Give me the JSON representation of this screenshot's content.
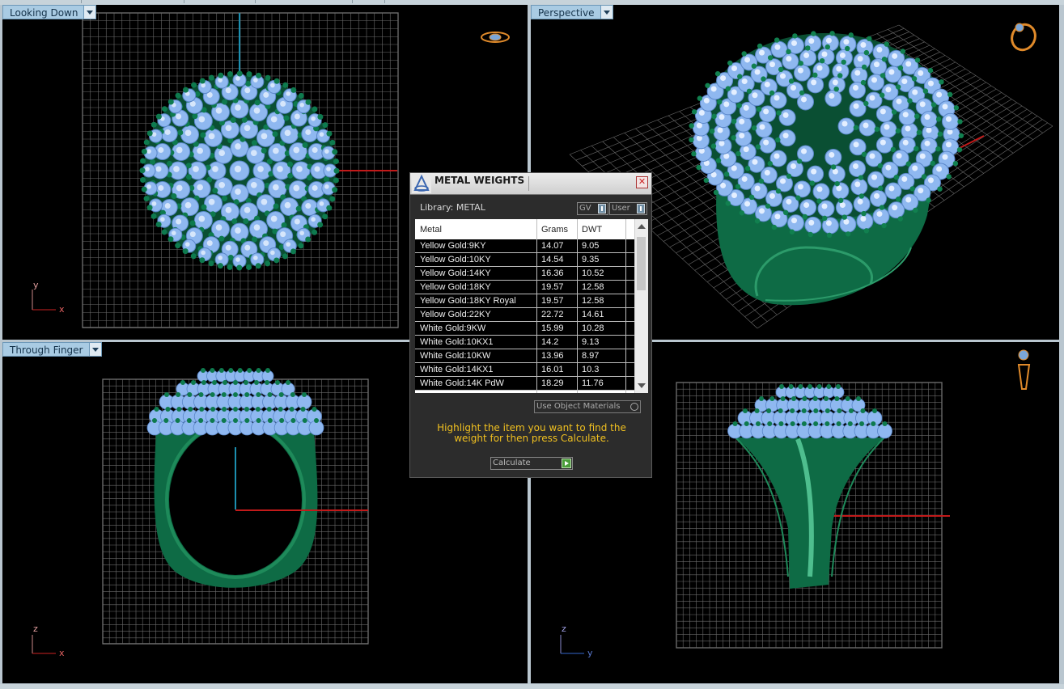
{
  "viewports": {
    "top_left": {
      "label": "Looking Down",
      "axis_v": "y",
      "axis_h": "x"
    },
    "top_right": {
      "label": "Perspective"
    },
    "bottom_left": {
      "label": "Through Finger",
      "axis_v": "z",
      "axis_h": "x"
    },
    "bottom_right": {
      "label": "",
      "axis_v": "z",
      "axis_h": "y"
    }
  },
  "dialog": {
    "title": "METAL WEIGHTS",
    "library_label": "Library: METAL",
    "toggle_gv": "GV",
    "toggle_user": "User",
    "columns": [
      "Metal",
      "Grams",
      "DWT"
    ],
    "rows": [
      {
        "metal": "Yellow Gold:9KY",
        "grams": "14.07",
        "dwt": "9.05"
      },
      {
        "metal": "Yellow Gold:10KY",
        "grams": "14.54",
        "dwt": "9.35"
      },
      {
        "metal": "Yellow Gold:14KY",
        "grams": "16.36",
        "dwt": "10.52"
      },
      {
        "metal": "Yellow Gold:18KY",
        "grams": "19.57",
        "dwt": "12.58"
      },
      {
        "metal": "Yellow Gold:18KY Royal",
        "grams": "19.57",
        "dwt": "12.58"
      },
      {
        "metal": "Yellow Gold:22KY",
        "grams": "22.72",
        "dwt": "14.61"
      },
      {
        "metal": "White Gold:9KW",
        "grams": "15.99",
        "dwt": "10.28"
      },
      {
        "metal": "White Gold:10KX1",
        "grams": "14.2",
        "dwt": "9.13"
      },
      {
        "metal": "White Gold:10KW",
        "grams": "13.96",
        "dwt": "8.97"
      },
      {
        "metal": "White Gold:14KX1",
        "grams": "16.01",
        "dwt": "10.3"
      },
      {
        "metal": "White Gold:14K PdW",
        "grams": "18.29",
        "dwt": "11.76"
      }
    ],
    "use_object_materials": "Use Object Materials",
    "hint": "Highlight the item you want to find the weight for then press Calculate.",
    "calculate": "Calculate"
  },
  "colors": {
    "metal": "#0e6b45",
    "gem": "#8fb8f0",
    "grid": "#6a6a6a",
    "axis_red": "#c21a1a",
    "axis_blue": "#1c8fb0",
    "label_bg": "#a9cbe3",
    "hint": "#f0c020"
  },
  "icons": {
    "top_left": "ring-top-icon",
    "top_right": "ring-perspective-icon",
    "bottom_right": "ring-side-icon",
    "dialog": "metal-weights-logo-icon"
  }
}
